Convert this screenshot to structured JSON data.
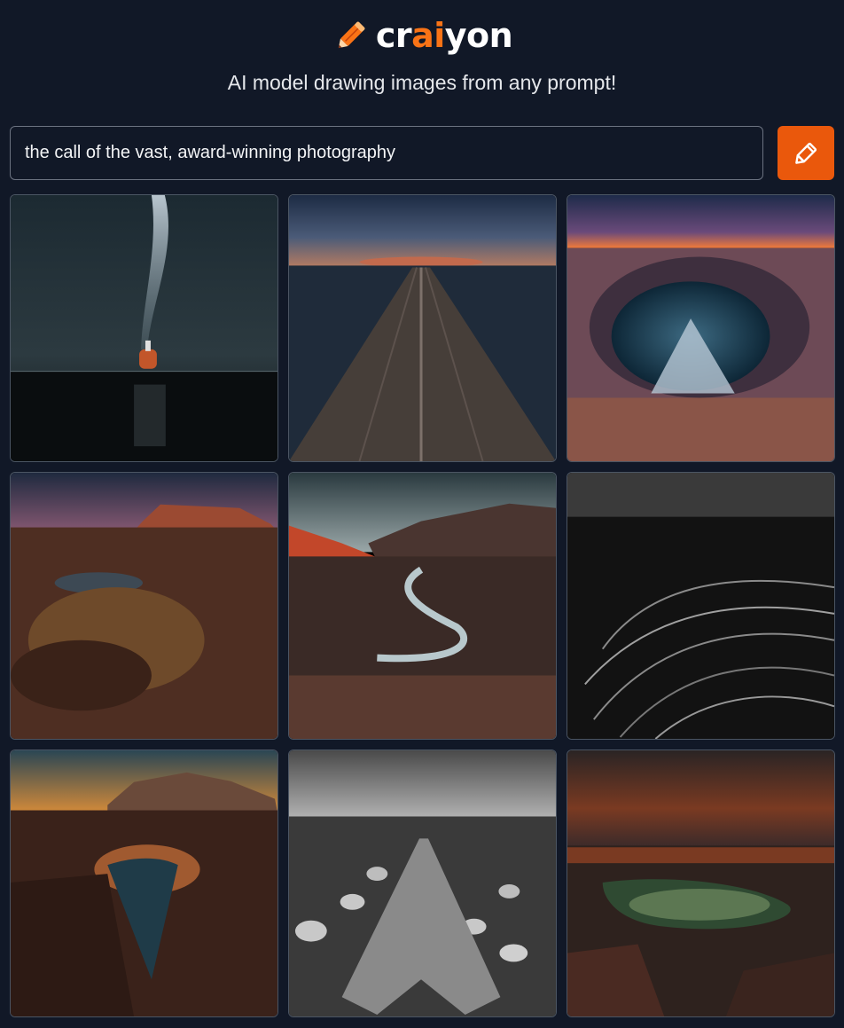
{
  "app": {
    "logo_prefix": "cr",
    "logo_accent": "ai",
    "logo_suffix": "yon",
    "logo_icon": "pencil-icon",
    "tagline": "AI model drawing images from any prompt!"
  },
  "prompt": {
    "value": "the call of the vast, award-winning photography",
    "button_icon": "pencil-icon"
  },
  "colors": {
    "background": "#111827",
    "accent": "#f97316",
    "button": "#ea580c",
    "border": "#6b7280"
  },
  "images": [
    {
      "icon": "image-milky-way-lake"
    },
    {
      "icon": "image-road-to-horizon"
    },
    {
      "icon": "image-crater-lake"
    },
    {
      "icon": "image-mesa-grassland"
    },
    {
      "icon": "image-river-valley"
    },
    {
      "icon": "image-monochrome-dunes"
    },
    {
      "icon": "image-canyon-pool-sunset"
    },
    {
      "icon": "image-monochrome-stones"
    },
    {
      "icon": "image-stormy-coast"
    }
  ]
}
